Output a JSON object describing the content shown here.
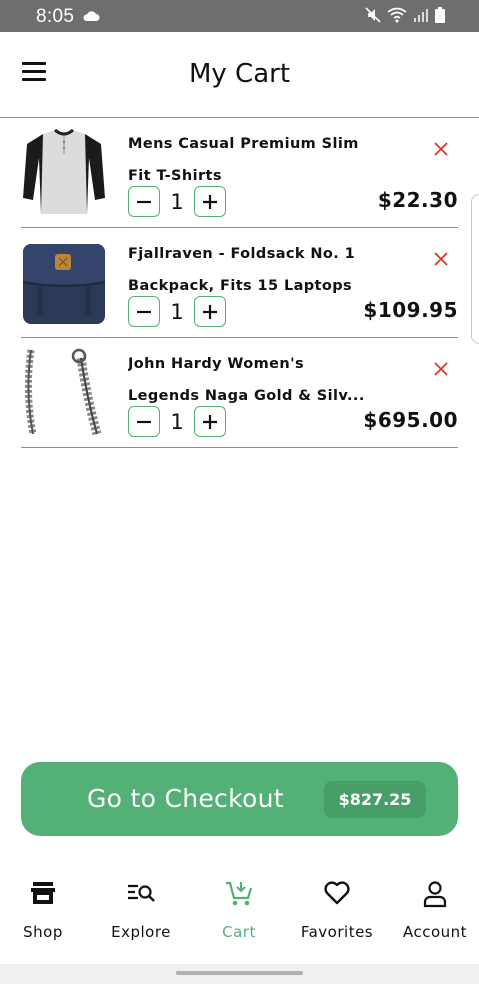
{
  "status_bar": {
    "time": "8:05",
    "icons": [
      "cloud-icon",
      "mute-icon",
      "wifi-icon",
      "signal-icon",
      "battery-icon"
    ]
  },
  "header": {
    "title": "My Cart",
    "menu_icon": "hamburger-menu-icon"
  },
  "cart": {
    "items": [
      {
        "title_line1": "Mens Casual Premium Slim",
        "title_line2": "Fit T-Shirts",
        "quantity": "1",
        "price": "$22.30",
        "image": "tshirt-image"
      },
      {
        "title_line1": "Fjallraven - Foldsack No. 1",
        "title_line2": "Backpack, Fits 15 Laptops",
        "quantity": "1",
        "price": "$109.95",
        "image": "backpack-image"
      },
      {
        "title_line1": "John Hardy Women's",
        "title_line2": "Legends Naga Gold & Silv...",
        "quantity": "1",
        "price": "$695.00",
        "image": "bracelet-image"
      }
    ]
  },
  "checkout": {
    "label": "Go to Checkout",
    "total": "$827.25"
  },
  "nav": {
    "items": [
      {
        "label": "Shop",
        "icon": "store-icon"
      },
      {
        "label": "Explore",
        "icon": "explore-search-icon"
      },
      {
        "label": "Cart",
        "icon": "cart-icon"
      },
      {
        "label": "Favorites",
        "icon": "heart-icon"
      },
      {
        "label": "Account",
        "icon": "person-icon"
      }
    ],
    "active": "Cart"
  },
  "colors": {
    "accent": "#53b175",
    "remove": "#d9392b",
    "status_bar": "#6e6e6e"
  }
}
